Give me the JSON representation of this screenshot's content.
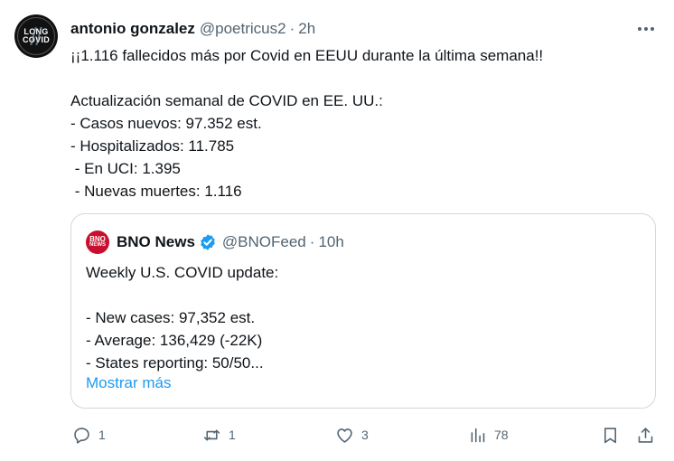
{
  "author": {
    "name": "antonio gonzalez",
    "handle": "@poetricus2",
    "separator": "·",
    "time": "2h",
    "avatar_text_top": "LONG",
    "avatar_text_bottom": "COVID"
  },
  "tweet_text": "¡¡1.116 fallecidos más por Covid en EEUU durante la última semana!!\n\nActualización semanal de COVID en EE. UU.:\n- Casos nuevos: 97.352 est.\n- Hospitalizados: 11.785\n - En UCI: 1.395\n - Nuevas muertes: 1.116",
  "quote": {
    "avatar_line1": "BNO",
    "avatar_line2": "NEWS",
    "name": "BNO News",
    "handle": "@BNOFeed",
    "separator": "·",
    "time": "10h",
    "text": "Weekly U.S. COVID update:\n\n- New cases: 97,352 est.\n- Average: 136,429 (-22K)\n- States reporting: 50/50...",
    "show_more": "Mostrar más"
  },
  "actions": {
    "replies": "1",
    "retweets": "1",
    "likes": "3",
    "views": "78"
  },
  "colors": {
    "text": "#0f1419",
    "secondary": "#536471",
    "link": "#1d9bf0",
    "verified": "#1d9bf0",
    "border": "#cfd9de"
  },
  "icons": [
    "more-icon",
    "verified-icon",
    "reply-icon",
    "retweet-icon",
    "like-icon",
    "views-icon",
    "bookmark-icon",
    "share-icon"
  ]
}
